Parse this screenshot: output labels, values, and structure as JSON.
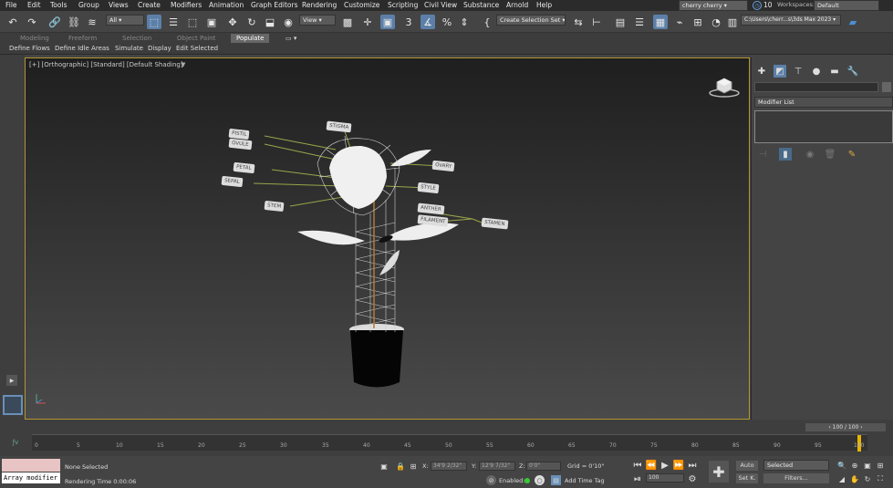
{
  "menu": [
    "File",
    "Edit",
    "Tools",
    "Group",
    "Views",
    "Create",
    "Modifiers",
    "Animation",
    "Graph Editors",
    "Rendering",
    "Customize",
    "Scripting",
    "Civil View",
    "Substance",
    "Arnold",
    "Help"
  ],
  "user": "cherry cherry",
  "notifications": "10",
  "workspaces_label": "Workspaces:",
  "workspace": "Default",
  "selection_filter": "All",
  "ref_coord": "View",
  "selection_set": "Create Selection Set",
  "project_path": "C:\\Users\\cherr...s\\3ds Max 2023",
  "ribbon_tabs": [
    "Modeling",
    "Freeform",
    "Selection",
    "Object Paint",
    "Populate"
  ],
  "ribbon_sub": [
    "Define Flows",
    "Define Idle Areas",
    "Simulate",
    "Display",
    "Edit Selected"
  ],
  "viewport_label": "[+] [Orthographic] [Standard] [Default Shading]",
  "callouts": [
    "STIGMA",
    "PISTIL",
    "OVULE",
    "PETAL",
    "SEPAL",
    "STEM",
    "OVARY",
    "STYLE",
    "ANTHER",
    "FILAMENT",
    "STAMEN"
  ],
  "modifier_list": "Modifier List",
  "frame_counter": "100 / 100",
  "timeline_ticks": [
    "0",
    "5",
    "10",
    "15",
    "20",
    "25",
    "30",
    "35",
    "40",
    "45",
    "50",
    "55",
    "60",
    "65",
    "70",
    "75",
    "80",
    "85",
    "90",
    "95",
    "100"
  ],
  "status": {
    "maxscript": "Array modifier",
    "selection": "None Selected",
    "render_time": "Rendering Time  0:00:06",
    "x_label": "X:",
    "x_val": "34'9 2/32\"",
    "y_label": "Y:",
    "y_val": "12'9 7/32\"",
    "z_label": "Z:",
    "z_val": "0'0\"",
    "grid": "Grid = 0'10\"",
    "enabled": "Enabled:",
    "add_time_tag": "Add Time Tag",
    "frame": "100",
    "auto": "Auto",
    "set_key": "Set K.",
    "key_filter": "Selected",
    "filters": "Filters..."
  }
}
